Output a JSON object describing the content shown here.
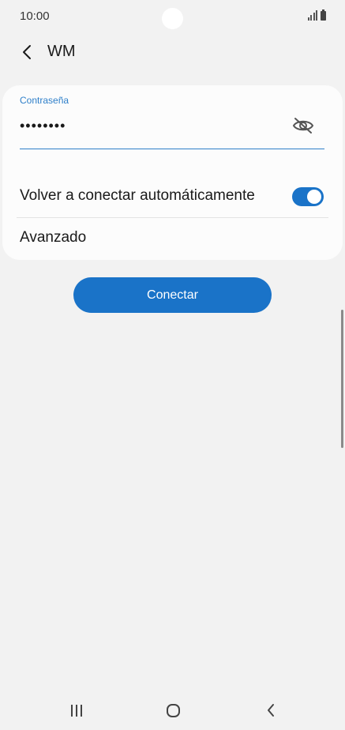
{
  "status_bar": {
    "time": "10:00",
    "icons": [
      "signal-icon",
      "battery-icon"
    ]
  },
  "header": {
    "title": "WM",
    "back_icon": "chevron-left-icon"
  },
  "password": {
    "label": "Contraseña",
    "value": "••••••••",
    "visibility_icon": "eye-off-icon"
  },
  "settings": {
    "auto_reconnect_label": "Volver a conectar automáticamente",
    "auto_reconnect_enabled": true,
    "advanced_label": "Avanzado"
  },
  "connect_button": {
    "label": "Conectar"
  },
  "nav_bar": {
    "recents_icon": "recents-icon",
    "home_icon": "home-icon",
    "back_icon": "back-icon"
  },
  "colors": {
    "accent": "#1a73c8",
    "label_accent": "#2e7fc9",
    "background": "#f2f2f2",
    "card": "#fcfcfc"
  }
}
